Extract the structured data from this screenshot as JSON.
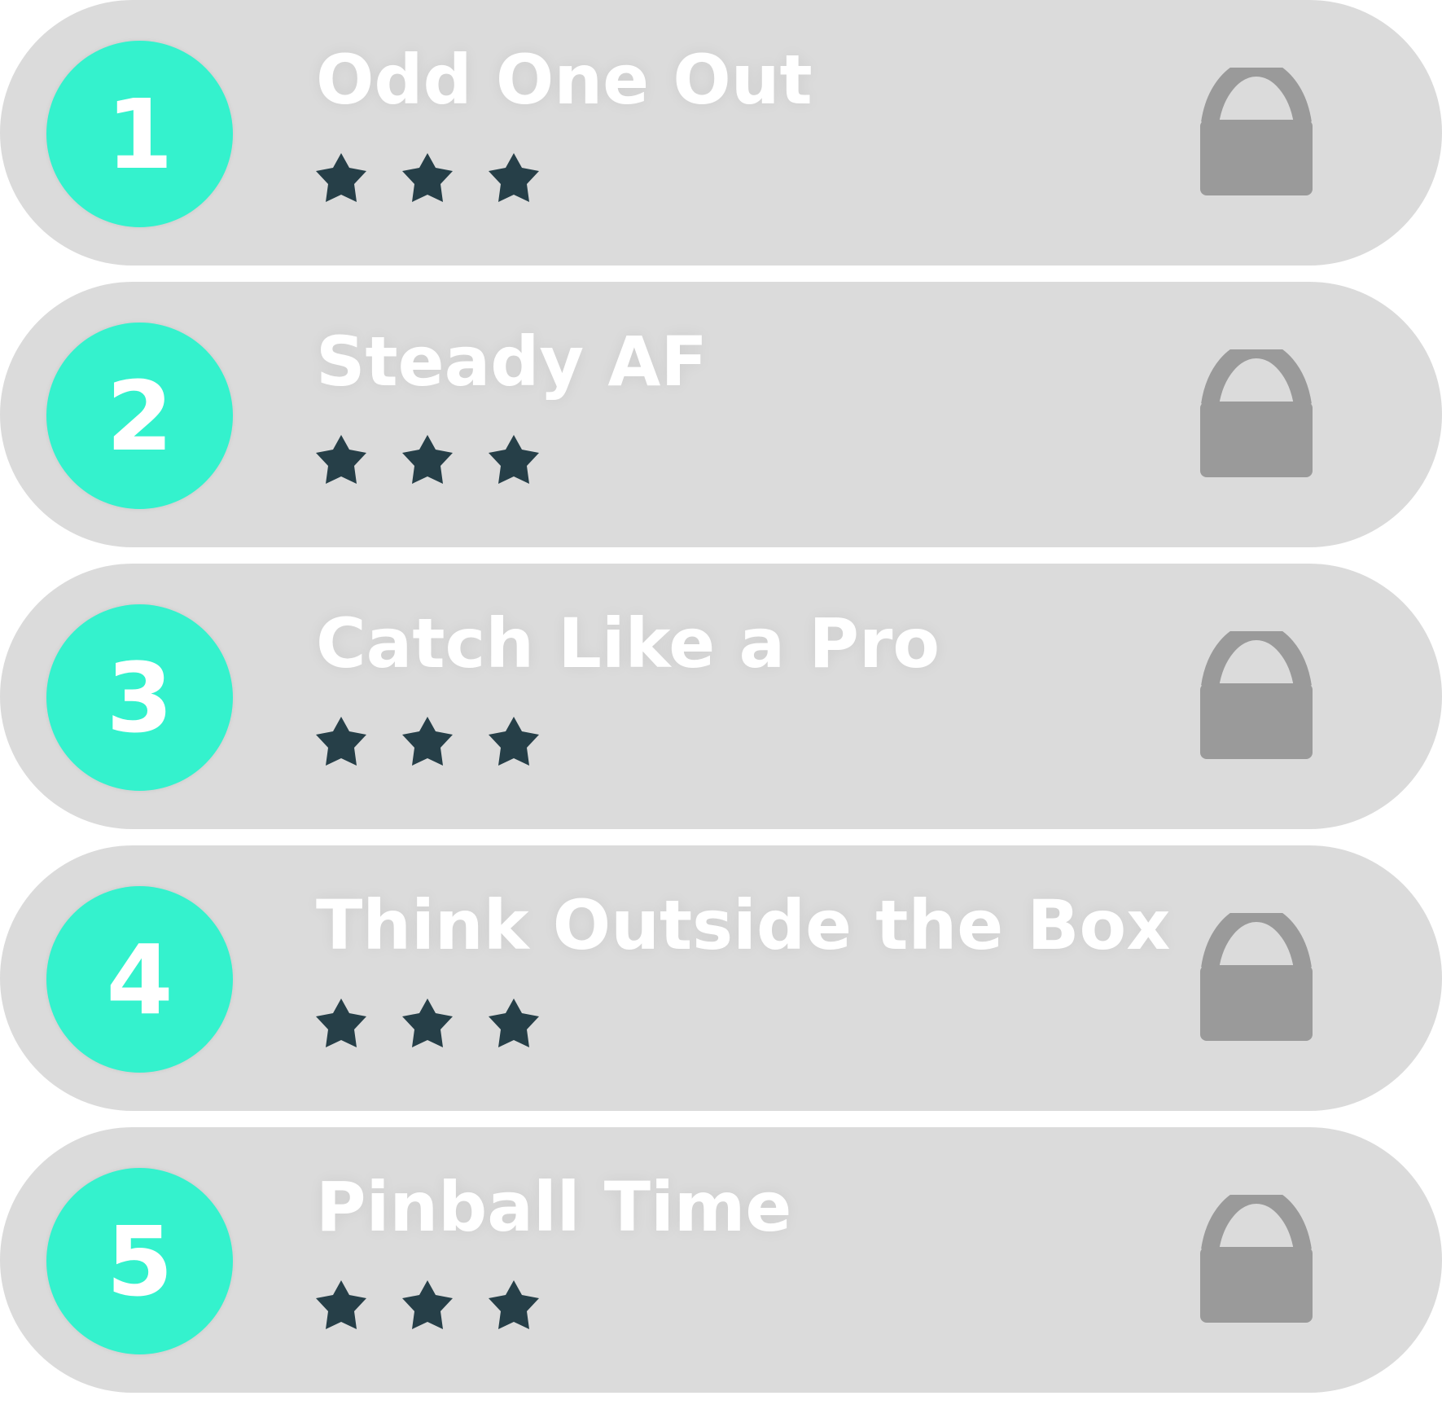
{
  "levels": [
    {
      "number": "1",
      "title": "Odd One Out",
      "stars_earned": 3,
      "stars_total": 3,
      "locked": true
    },
    {
      "number": "2",
      "title": "Steady AF",
      "stars_earned": 3,
      "stars_total": 3,
      "locked": true
    },
    {
      "number": "3",
      "title": "Catch Like a Pro",
      "stars_earned": 3,
      "stars_total": 3,
      "locked": true
    },
    {
      "number": "4",
      "title": "Think Outside the Box",
      "stars_earned": 3,
      "stars_total": 3,
      "locked": true
    },
    {
      "number": "5",
      "title": "Pinball Time",
      "stars_earned": 3,
      "stars_total": 3,
      "locked": true
    }
  ],
  "colors": {
    "card_background": "#dbdbdb",
    "badge": "#34f2cd",
    "text": "#ffffff",
    "star": "#263f48",
    "lock": "#9a9a9a"
  },
  "icons": {
    "star": "star-icon",
    "lock": "lock-icon"
  }
}
